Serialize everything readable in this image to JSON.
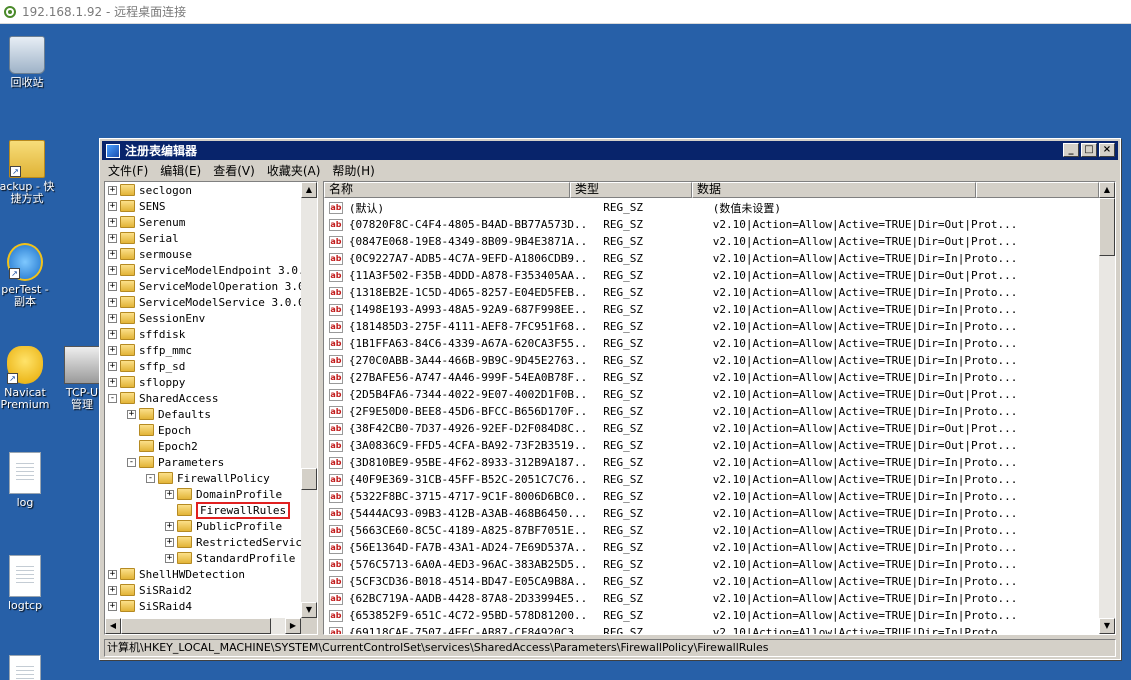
{
  "rdp": {
    "title": "192.168.1.92 - 远程桌面连接"
  },
  "desktop": {
    "recycle_bin": "回收站",
    "backup_shortcut": [
      "ackup - 快",
      "捷方式"
    ],
    "supertest": [
      "perTest -",
      "副本"
    ],
    "navicat": [
      "Navicat",
      "Premium"
    ],
    "tcp": [
      "TCP-U",
      "管理"
    ],
    "log": "log",
    "logtcp": "logtcp"
  },
  "window": {
    "title": "注册表编辑器",
    "menu": [
      "文件(F)",
      "编辑(E)",
      "查看(V)",
      "收藏夹(A)",
      "帮助(H)"
    ],
    "controls": [
      "_",
      "□",
      "×"
    ]
  },
  "tree": [
    {
      "label": "seclogon",
      "level": 0,
      "box": "+"
    },
    {
      "label": "SENS",
      "level": 0,
      "box": "+"
    },
    {
      "label": "Serenum",
      "level": 0,
      "box": "+"
    },
    {
      "label": "Serial",
      "level": 0,
      "box": "+"
    },
    {
      "label": "sermouse",
      "level": 0,
      "box": "+"
    },
    {
      "label": "ServiceModelEndpoint 3.0.0.0",
      "level": 0,
      "box": "+"
    },
    {
      "label": "ServiceModelOperation 3.0.0.0",
      "level": 0,
      "box": "+"
    },
    {
      "label": "ServiceModelService 3.0.0.0",
      "level": 0,
      "box": "+"
    },
    {
      "label": "SessionEnv",
      "level": 0,
      "box": "+"
    },
    {
      "label": "sffdisk",
      "level": 0,
      "box": "+"
    },
    {
      "label": "sffp_mmc",
      "level": 0,
      "box": "+"
    },
    {
      "label": "sffp_sd",
      "level": 0,
      "box": "+"
    },
    {
      "label": "sfloppy",
      "level": 0,
      "box": "+"
    },
    {
      "label": "SharedAccess",
      "level": 0,
      "box": "-"
    },
    {
      "label": "Defaults",
      "level": 1,
      "box": "+"
    },
    {
      "label": "Epoch",
      "level": 1,
      "box": ""
    },
    {
      "label": "Epoch2",
      "level": 1,
      "box": ""
    },
    {
      "label": "Parameters",
      "level": 1,
      "box": "-"
    },
    {
      "label": "FirewallPolicy",
      "level": 2,
      "box": "-"
    },
    {
      "label": "DomainProfile",
      "level": 3,
      "box": "+"
    },
    {
      "label": "FirewallRules",
      "level": 3,
      "box": "",
      "selected": true
    },
    {
      "label": "PublicProfile",
      "level": 3,
      "box": "+"
    },
    {
      "label": "RestrictedServices",
      "level": 3,
      "box": "+"
    },
    {
      "label": "StandardProfile",
      "level": 3,
      "box": "+"
    },
    {
      "label": "ShellHWDetection",
      "level": 0,
      "box": "+"
    },
    {
      "label": "SiSRaid2",
      "level": 0,
      "box": "+"
    },
    {
      "label": "SiSRaid4",
      "level": 0,
      "box": "+"
    }
  ],
  "list": {
    "headers": [
      "名称",
      "类型",
      "数据"
    ],
    "rows": [
      {
        "name": "(默认)",
        "type": "REG_SZ",
        "data": "(数值未设置)"
      },
      {
        "name": "{07820F8C-C4F4-4805-B4AD-BB77A573D...",
        "type": "REG_SZ",
        "data": "v2.10|Action=Allow|Active=TRUE|Dir=Out|Prot..."
      },
      {
        "name": "{0847E068-19E8-4349-8B09-9B4E3871A...",
        "type": "REG_SZ",
        "data": "v2.10|Action=Allow|Active=TRUE|Dir=Out|Prot..."
      },
      {
        "name": "{0C9227A7-ADB5-4C7A-9EFD-A1806CDB9...",
        "type": "REG_SZ",
        "data": "v2.10|Action=Allow|Active=TRUE|Dir=In|Proto..."
      },
      {
        "name": "{11A3F502-F35B-4DDD-A878-F353405AA...",
        "type": "REG_SZ",
        "data": "v2.10|Action=Allow|Active=TRUE|Dir=Out|Prot..."
      },
      {
        "name": "{1318EB2E-1C5D-4D65-8257-E04ED5FEB...",
        "type": "REG_SZ",
        "data": "v2.10|Action=Allow|Active=TRUE|Dir=In|Proto..."
      },
      {
        "name": "{1498E193-A993-48A5-92A9-687F998EE...",
        "type": "REG_SZ",
        "data": "v2.10|Action=Allow|Active=TRUE|Dir=In|Proto..."
      },
      {
        "name": "{181485D3-275F-4111-AEF8-7FC951F68...",
        "type": "REG_SZ",
        "data": "v2.10|Action=Allow|Active=TRUE|Dir=In|Proto..."
      },
      {
        "name": "{1B1FFA63-84C6-4339-A67A-620CA3F55...",
        "type": "REG_SZ",
        "data": "v2.10|Action=Allow|Active=TRUE|Dir=In|Proto..."
      },
      {
        "name": "{270C0ABB-3A44-466B-9B9C-9D45E2763...",
        "type": "REG_SZ",
        "data": "v2.10|Action=Allow|Active=TRUE|Dir=In|Proto..."
      },
      {
        "name": "{27BAFE56-A747-4A46-999F-54EA0B78F...",
        "type": "REG_SZ",
        "data": "v2.10|Action=Allow|Active=TRUE|Dir=In|Proto..."
      },
      {
        "name": "{2D5B4FA6-7344-4022-9E07-4002D1F0B...",
        "type": "REG_SZ",
        "data": "v2.10|Action=Allow|Active=TRUE|Dir=Out|Prot..."
      },
      {
        "name": "{2F9E50D0-BEE8-45D6-BFCC-B656D170F...",
        "type": "REG_SZ",
        "data": "v2.10|Action=Allow|Active=TRUE|Dir=In|Proto..."
      },
      {
        "name": "{38F42CB0-7D37-4926-92EF-D2F084D8C...",
        "type": "REG_SZ",
        "data": "v2.10|Action=Allow|Active=TRUE|Dir=Out|Prot..."
      },
      {
        "name": "{3A0836C9-FFD5-4CFA-BA92-73F2B3519...",
        "type": "REG_SZ",
        "data": "v2.10|Action=Allow|Active=TRUE|Dir=Out|Prot..."
      },
      {
        "name": "{3D810BE9-95BE-4F62-8933-312B9A187...",
        "type": "REG_SZ",
        "data": "v2.10|Action=Allow|Active=TRUE|Dir=In|Proto..."
      },
      {
        "name": "{40F9E369-31CB-45FF-B52C-2051C7C76...",
        "type": "REG_SZ",
        "data": "v2.10|Action=Allow|Active=TRUE|Dir=In|Proto..."
      },
      {
        "name": "{5322F8BC-3715-4717-9C1F-8006D6BC0...",
        "type": "REG_SZ",
        "data": "v2.10|Action=Allow|Active=TRUE|Dir=In|Proto..."
      },
      {
        "name": "{5444AC93-09B3-412B-A3AB-468B6450...",
        "type": "REG_SZ",
        "data": "v2.10|Action=Allow|Active=TRUE|Dir=In|Proto..."
      },
      {
        "name": "{5663CE60-8C5C-4189-A825-87BF7051E...",
        "type": "REG_SZ",
        "data": "v2.10|Action=Allow|Active=TRUE|Dir=In|Proto..."
      },
      {
        "name": "{56E1364D-FA7B-43A1-AD24-7E69D537A...",
        "type": "REG_SZ",
        "data": "v2.10|Action=Allow|Active=TRUE|Dir=In|Proto..."
      },
      {
        "name": "{576C5713-6A0A-4ED3-96AC-383AB25D5...",
        "type": "REG_SZ",
        "data": "v2.10|Action=Allow|Active=TRUE|Dir=In|Proto..."
      },
      {
        "name": "{5CF3CD36-B018-4514-BD47-E05CA9B8A...",
        "type": "REG_SZ",
        "data": "v2.10|Action=Allow|Active=TRUE|Dir=In|Proto..."
      },
      {
        "name": "{62BC719A-AADB-4428-87A8-2D33994E5...",
        "type": "REG_SZ",
        "data": "v2.10|Action=Allow|Active=TRUE|Dir=In|Proto..."
      },
      {
        "name": "{653852F9-651C-4C72-95BD-578D81200...",
        "type": "REG_SZ",
        "data": "v2.10|Action=Allow|Active=TRUE|Dir=In|Proto..."
      },
      {
        "name": "{69118CAE-7507-4EEC-AB87-CF84920C3...",
        "type": "REG_SZ",
        "data": "v2.10|Action=Allow|Active=TRUE|Dir=In|Proto..."
      }
    ]
  },
  "status": "计算机\\HKEY_LOCAL_MACHINE\\SYSTEM\\CurrentControlSet\\services\\SharedAccess\\Parameters\\FirewallPolicy\\FirewallRules"
}
